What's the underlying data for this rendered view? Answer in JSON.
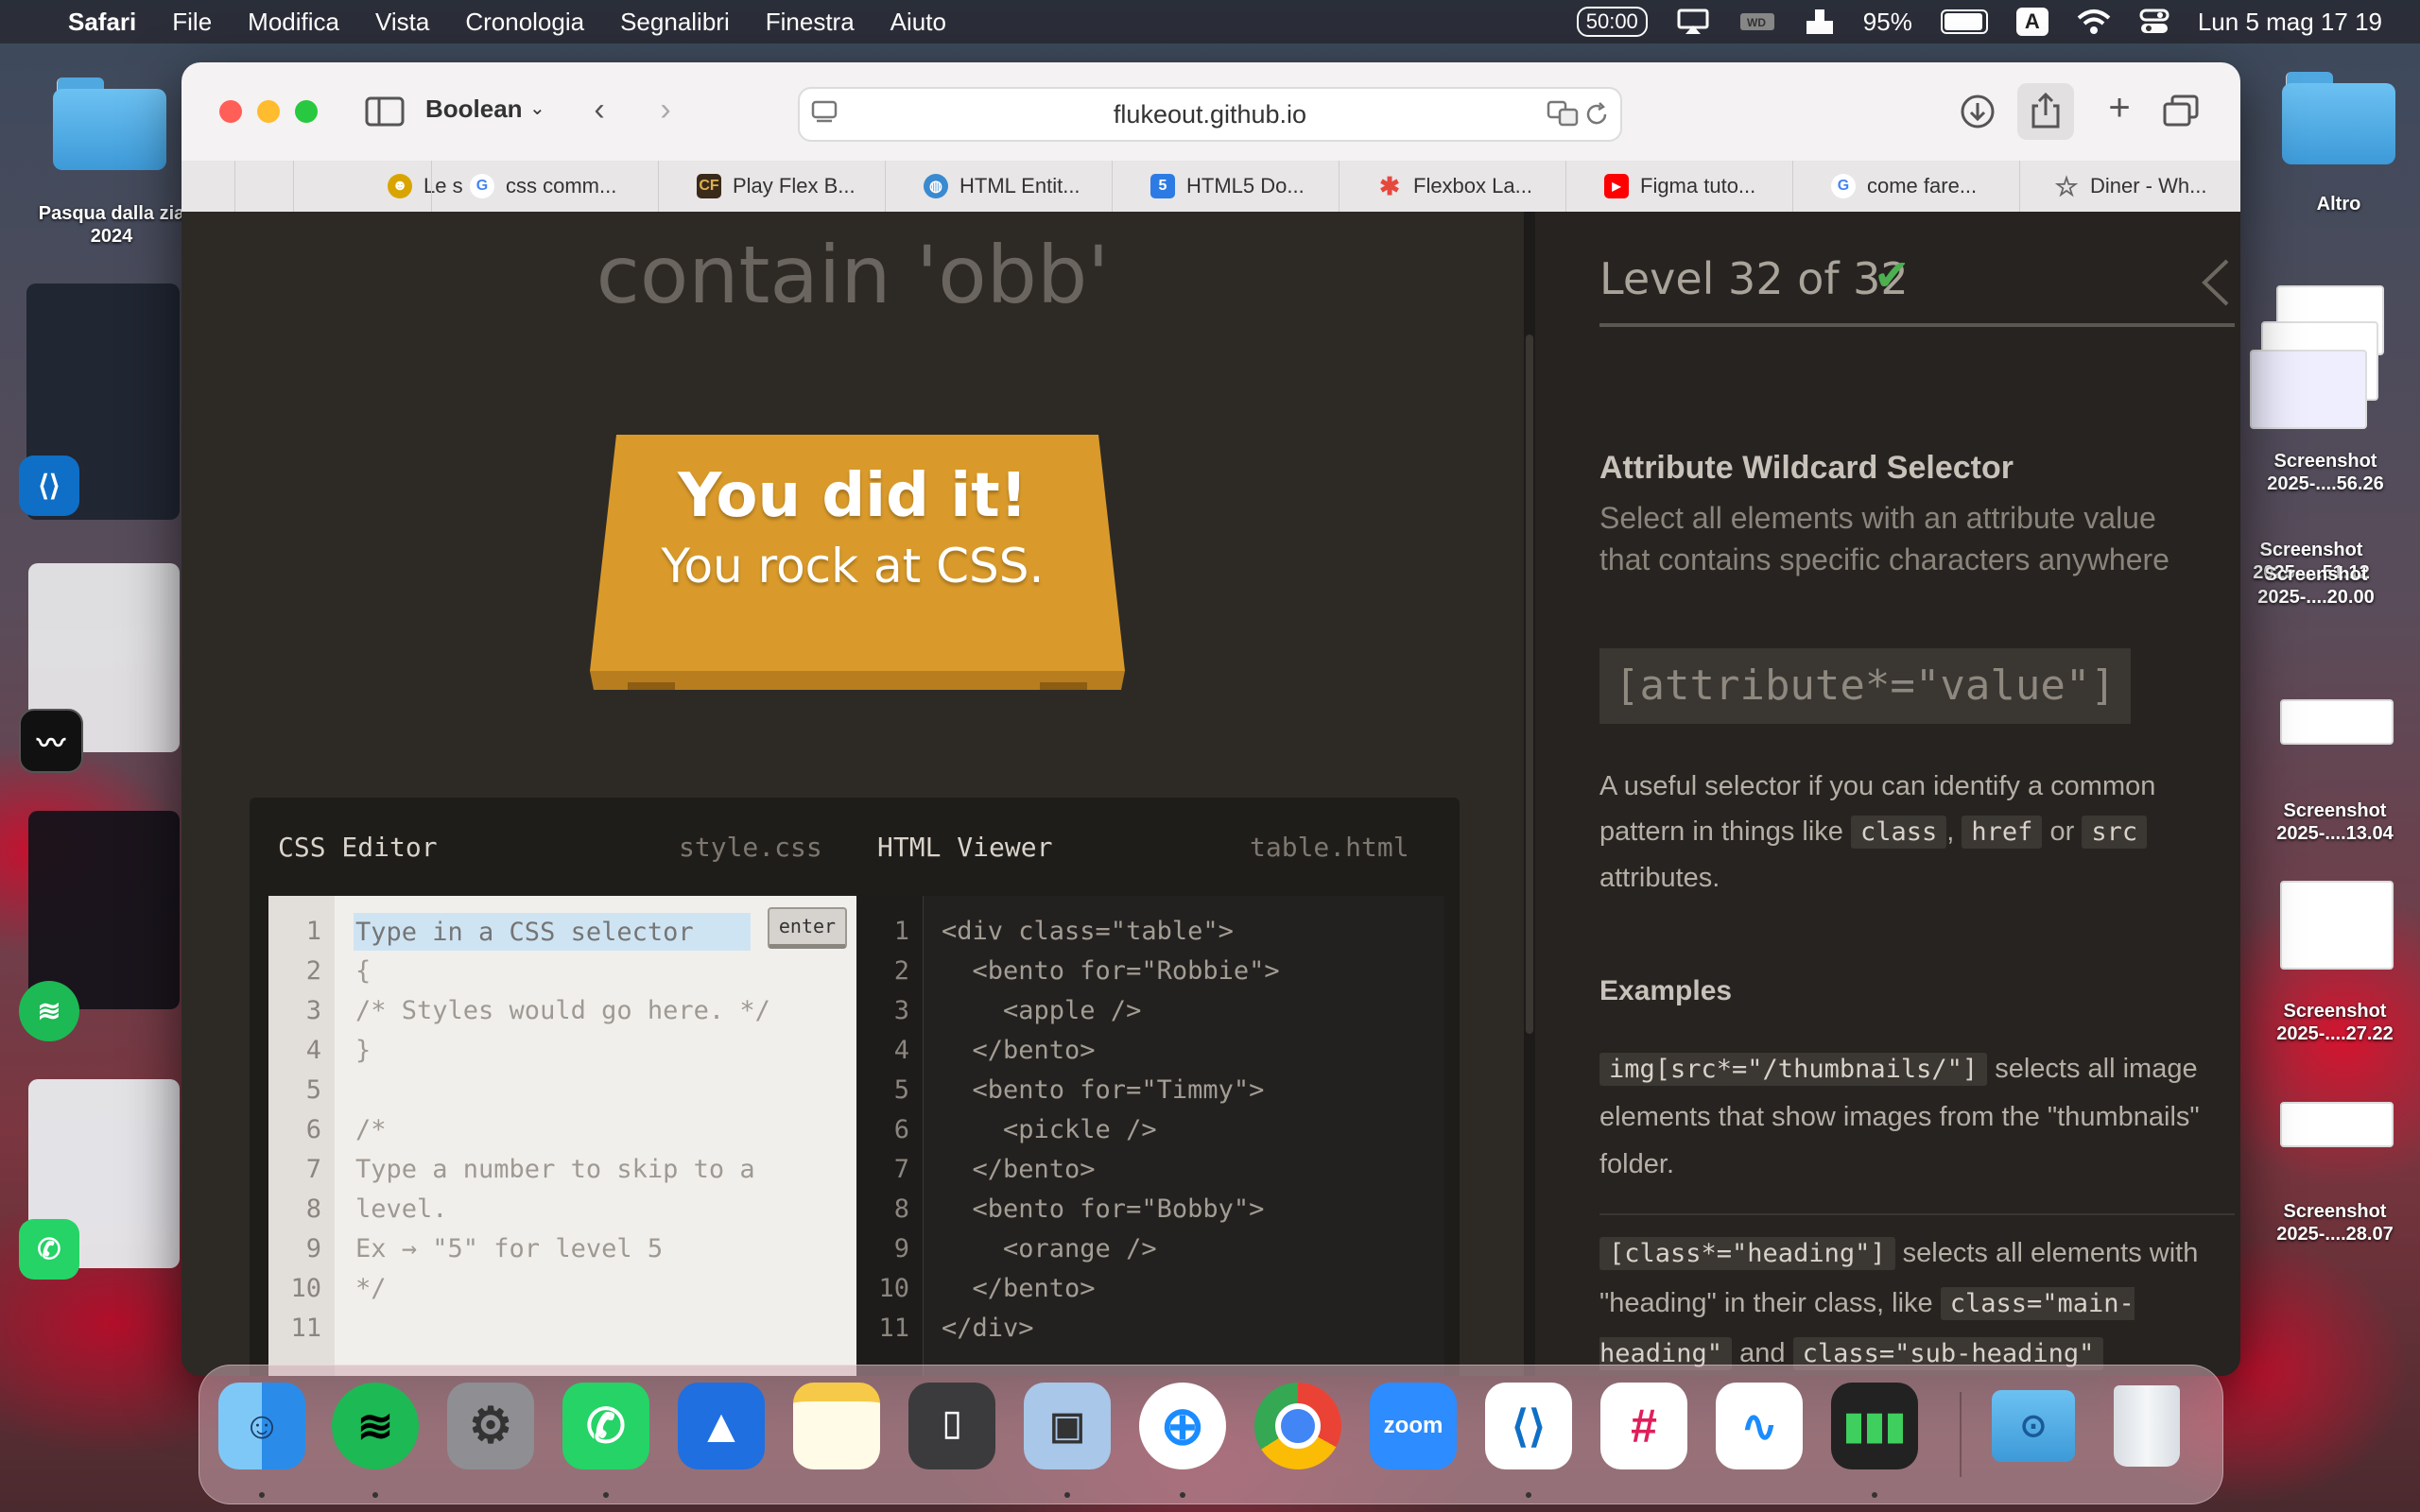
{
  "menubar": {
    "app_name": "Safari",
    "items": [
      "File",
      "Modifica",
      "Vista",
      "Cronologia",
      "Segnalibri",
      "Finestra",
      "Aiuto"
    ],
    "time_pill": "50:00",
    "battery": "95%",
    "input_source": "A",
    "datetime": "Lun 5 mag  17 19"
  },
  "desktop": {
    "folder_left_label": "Pasqua dalla zia 2024",
    "folder_right_label": "Altro",
    "screenshots": [
      "Screenshot 2025-....56.26",
      "Screenshot 2025-....51.12",
      "Screenshot 2025-....20.00",
      "Screenshot 2025-....13.04",
      "Screenshot 2025-....27.22",
      "Screenshot 2025-....28.07"
    ]
  },
  "browser": {
    "profile": "Boolean",
    "url": "flukeout.github.io",
    "tabs": [
      {
        "label": "Le s",
        "icon": "person-icon",
        "color": "#d9a400"
      },
      {
        "label": "css comm...",
        "icon": "google-icon",
        "color": "#4285f4"
      },
      {
        "label": "Play Flex B...",
        "icon": "cf-icon",
        "color": "#3a2a1a"
      },
      {
        "label": "HTML Entit...",
        "icon": "globe-icon",
        "color": "#3a8ad0"
      },
      {
        "label": "HTML5 Do...",
        "icon": "html5-icon",
        "color": "#2c7be5"
      },
      {
        "label": "Flexbox La...",
        "icon": "asterisk-icon",
        "color": "#e5483d"
      },
      {
        "label": "Figma tuto...",
        "icon": "youtube-icon",
        "color": "#ff0000"
      },
      {
        "label": "come fare...",
        "icon": "google-icon",
        "color": "#4285f4"
      },
      {
        "label": "Diner - Wh...",
        "icon": "star-icon",
        "color": "#666666"
      }
    ]
  },
  "game": {
    "order": "contain 'obb'",
    "win_title": "You did it!",
    "win_subtitle": "You rock at CSS.",
    "css_editor": {
      "title": "CSS Editor",
      "file": "style.css",
      "placeholder": "Type in a CSS selector",
      "enter_label": "enter",
      "line_numbers": [
        "1",
        "2",
        "3",
        "4",
        "5",
        "6",
        "7",
        "8",
        "9",
        "10",
        "11"
      ],
      "lines": [
        "",
        "{",
        "/* Styles would go here. */",
        "}",
        "",
        "/*",
        "Type a number to skip to a",
        "level.",
        "Ex → \"5\" for level 5",
        "*/",
        ""
      ]
    },
    "html_viewer": {
      "title": "HTML Viewer",
      "file": "table.html",
      "line_numbers": [
        "1",
        "2",
        "3",
        "4",
        "5",
        "6",
        "7",
        "8",
        "9",
        "10",
        "11"
      ],
      "lines": [
        "<div class=\"table\">",
        "  <bento for=\"Robbie\">",
        "    <apple />",
        "  </bento>",
        "  <bento for=\"Timmy\">",
        "    <pickle />",
        "  </bento>",
        "  <bento for=\"Bobby\">",
        "    <orange />",
        "  </bento>",
        "</div>"
      ]
    }
  },
  "sidebar": {
    "level": "Level 32 of 32",
    "check": "✔",
    "title": "Attribute Wildcard Selector",
    "description": "Select all elements with an attribute value that contains specific characters anywhere",
    "syntax": "[attribute*=\"value\"]",
    "hint_before": "A useful selector if you can identify a common pattern in things like",
    "hint_class": "class",
    "hint_comma": ",",
    "hint_href": "href",
    "hint_or": "or",
    "hint_src": "src",
    "hint_after": "attributes.",
    "examples_title": "Examples",
    "ex1_code": "img[src*=\"/thumbnails/\"]",
    "ex1_text": "selects all image elements that show images from the \"thumbnails\" folder.",
    "ex2_code": "[class*=\"heading\"]",
    "ex2_text_1": "selects all elements with \"heading\" in their class, like",
    "ex2_code_2": "class=\"main-heading\"",
    "ex2_and": "and",
    "ex2_code_3": "class=\"sub-heading\""
  },
  "colors": {
    "table_orange": "#d99a2b",
    "check_green": "#4caf50",
    "background": "#2d2a26"
  }
}
